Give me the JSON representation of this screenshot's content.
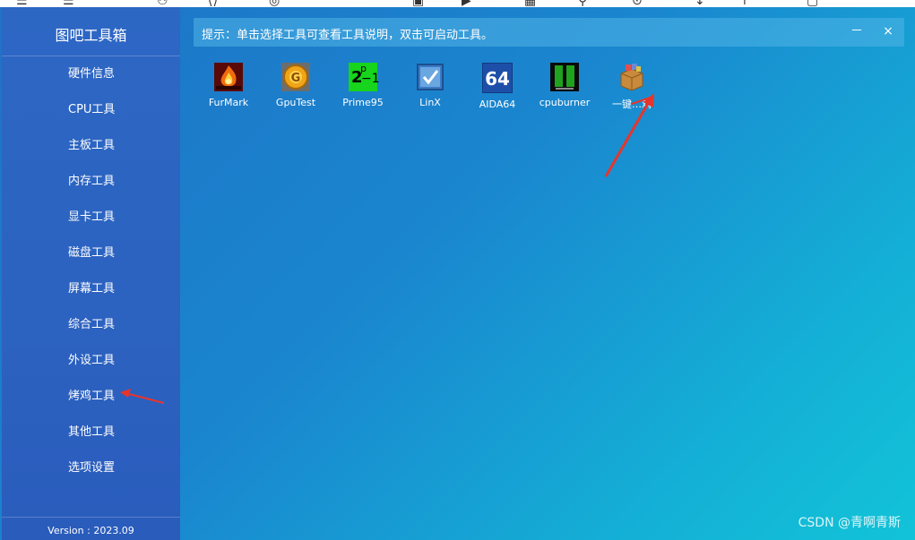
{
  "app": {
    "title": "图吧工具箱",
    "version": "Version : 2023.09"
  },
  "sidebar": {
    "items": [
      {
        "label": "硬件信息"
      },
      {
        "label": "CPU工具"
      },
      {
        "label": "主板工具"
      },
      {
        "label": "内存工具"
      },
      {
        "label": "显卡工具"
      },
      {
        "label": "磁盘工具"
      },
      {
        "label": "屏幕工具"
      },
      {
        "label": "综合工具"
      },
      {
        "label": "外设工具"
      },
      {
        "label": "烤鸡工具"
      },
      {
        "label": "其他工具"
      },
      {
        "label": "选项设置"
      }
    ]
  },
  "hintbar": {
    "text": "提示：单击选择工具可查看工具说明，双击可启动工具。",
    "minimize": "－",
    "close": "×"
  },
  "tools": [
    {
      "label": "FurMark",
      "icon": "furmark-icon"
    },
    {
      "label": "GpuTest",
      "icon": "gputest-icon"
    },
    {
      "label": "Prime95",
      "icon": "prime95-icon"
    },
    {
      "label": "LinX",
      "icon": "linx-icon"
    },
    {
      "label": "AIDA64",
      "icon": "aida64-icon"
    },
    {
      "label": "cpuburner",
      "icon": "cpuburner-icon"
    },
    {
      "label": "一键…鸡",
      "icon": "package-box-icon"
    }
  ],
  "icon_text": {
    "prime": "2",
    "prime_sup": "p",
    "prime_tail": "−1",
    "aida": "64"
  },
  "watermark": "CSDN @青啊青斯",
  "colors": {
    "sidebar": "#2c62c0",
    "accent_arrow": "#e8352b"
  }
}
